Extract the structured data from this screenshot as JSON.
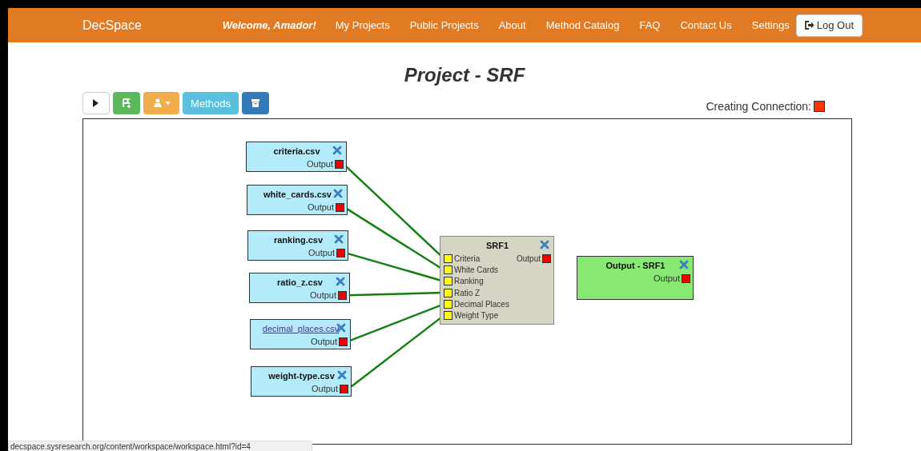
{
  "navbar": {
    "brand": "DecSpace",
    "welcome": "Welcome, Amador!",
    "links": [
      "My Projects",
      "Public Projects",
      "About",
      "Method Catalog",
      "FAQ",
      "Contact Us",
      "Settings"
    ],
    "logout": "Log Out"
  },
  "title": "Project - SRF",
  "toolbar": [
    {
      "kind": "run"
    },
    {
      "kind": "save"
    },
    {
      "kind": "import"
    },
    {
      "kind": "methods",
      "label": "Methods"
    },
    {
      "kind": "archive"
    }
  ],
  "connection_status": {
    "label": "Creating Connection:",
    "active": true
  },
  "workspace": {
    "nodes": [
      {
        "kind": "file",
        "title": "criteria.csv",
        "highlighted": false,
        "connected": true,
        "outputs": [
          "Output"
        ]
      },
      {
        "kind": "file",
        "title": "white_cards.csv",
        "highlighted": false,
        "connected": true,
        "outputs": [
          "Output"
        ]
      },
      {
        "kind": "file",
        "title": "ranking.csv",
        "highlighted": false,
        "connected": true,
        "outputs": [
          "Output"
        ]
      },
      {
        "kind": "file",
        "title": "ratio_z.csv",
        "highlighted": false,
        "connected": true,
        "outputs": [
          "Output"
        ]
      },
      {
        "kind": "file",
        "title": "decimal_places.csv",
        "highlighted": true,
        "connected": true,
        "outputs": [
          "Output"
        ]
      },
      {
        "kind": "file",
        "title": "weight-type.csv",
        "highlighted": false,
        "connected": true,
        "outputs": [
          "Output"
        ]
      },
      {
        "kind": "method",
        "title": "SRF1",
        "highlighted": false,
        "inputs": [
          "Criteria",
          "White Cards",
          "Ranking",
          "Ratio Z",
          "Decimal Places",
          "Weight Type"
        ],
        "outputs": [
          "Output"
        ]
      },
      {
        "kind": "result",
        "title": "Output - SRF1",
        "highlighted": false,
        "outputs": [
          "Output"
        ]
      }
    ]
  },
  "status_bar": "decspace.sysresearch.org/content/workspace/workspace.html?id=4"
}
